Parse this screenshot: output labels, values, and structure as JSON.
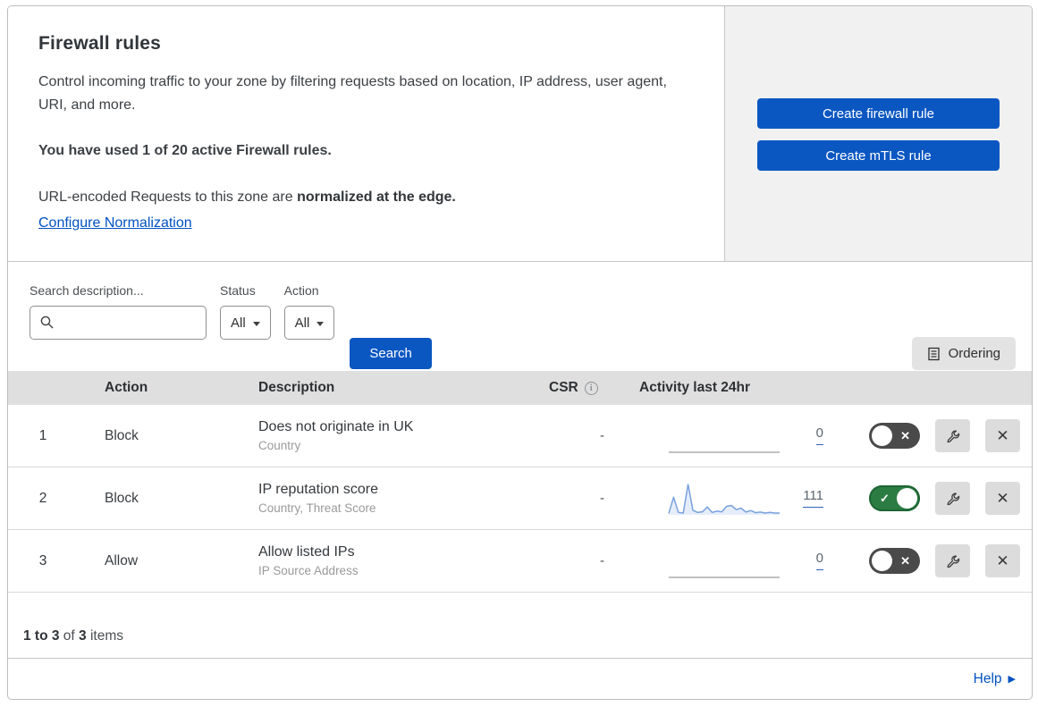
{
  "intro": {
    "title": "Firewall rules",
    "description": "Control incoming traffic to your zone by filtering requests based on location, IP address, user agent, URI, and more.",
    "usage": "You have used 1 of 20 active Firewall rules.",
    "normalization_prefix": "URL-encoded Requests to this zone are ",
    "normalization_bold": "normalized at the edge.",
    "normalization_link": "Configure Normalization"
  },
  "actions": {
    "create_firewall_rule": "Create firewall rule",
    "create_mtls_rule": "Create mTLS rule"
  },
  "filters": {
    "search_label": "Search description...",
    "search_value": "",
    "status_label": "Status",
    "status_value": "All",
    "action_label": "Action",
    "action_value": "All",
    "search_button": "Search",
    "ordering_button": "Ordering"
  },
  "table": {
    "columns": {
      "action": "Action",
      "description": "Description",
      "csr": "CSR",
      "activity": "Activity last 24hr"
    },
    "rows": [
      {
        "priority": "1",
        "action": "Block",
        "description": "Does not originate in UK",
        "fields": "Country",
        "csr": "-",
        "activity_count": "0",
        "enabled": false,
        "sparkline": []
      },
      {
        "priority": "2",
        "action": "Block",
        "description": "IP reputation score",
        "fields": "Country, Threat Score",
        "csr": "-",
        "activity_count": "111",
        "enabled": true,
        "sparkline": [
          5,
          58,
          8,
          6,
          100,
          15,
          8,
          10,
          26,
          8,
          12,
          10,
          28,
          31,
          17,
          22,
          9,
          14,
          7,
          9,
          6,
          8,
          6,
          6
        ]
      },
      {
        "priority": "3",
        "action": "Allow",
        "description": "Allow listed IPs",
        "fields": "IP Source Address",
        "csr": "-",
        "activity_count": "0",
        "enabled": false,
        "sparkline": []
      }
    ],
    "summary": {
      "range": "1 to 3",
      "of_text": " of ",
      "total": "3",
      "items_text": " items"
    }
  },
  "footer": {
    "help": "Help"
  },
  "icons": {
    "search": "search-icon",
    "info": "info-icon",
    "ordering": "list-document-icon",
    "wrench": "wrench-icon",
    "close": "close-icon",
    "toggle_check": "check-icon",
    "toggle_x": "x-icon",
    "help_arrow": "arrow-right-icon"
  },
  "colors": {
    "primary_blue": "#0b57c2",
    "link_blue": "#0051c3",
    "toggle_on_green": "#2b7c43",
    "toggle_off_gray": "#4a4a4a",
    "sparkline_blue": "#79a1dd",
    "panel_gray": "#f1f1f1",
    "table_header_gray": "#dfdfdf"
  }
}
